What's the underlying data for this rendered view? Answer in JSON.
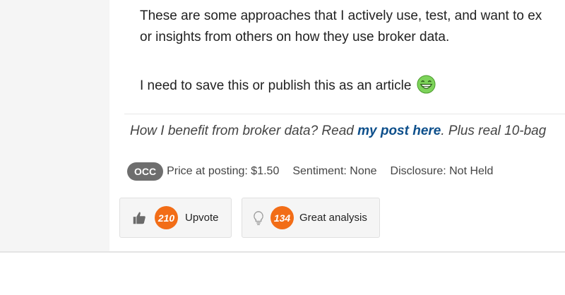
{
  "post": {
    "line1": "These are some approaches that I actively use, test, and want to ex",
    "line2": "or insights from others on how they use broker data.",
    "line3": "I need to save this or publish this as an article",
    "emoji_icon": "grinning-face-icon",
    "promo_prefix": "How I benefit from broker data? Read ",
    "promo_link": "my post here",
    "promo_suffix": ". Plus real 10-bag"
  },
  "meta": {
    "ticker": "OCC",
    "price": "Price at posting: $1.50",
    "sentiment": "Sentiment: None",
    "disclosure": "Disclosure: Not Held"
  },
  "actions": {
    "upvote": {
      "icon": "thumbs-up-icon",
      "count": "210",
      "label": "Upvote"
    },
    "insight": {
      "icon": "lightbulb-icon",
      "count": "134",
      "label": "Great analysis"
    }
  },
  "colors": {
    "badge": "#f26d17",
    "ticker_bg": "#6e6e6e",
    "link": "#0d4f8b",
    "emoji": "#7dd35a"
  }
}
